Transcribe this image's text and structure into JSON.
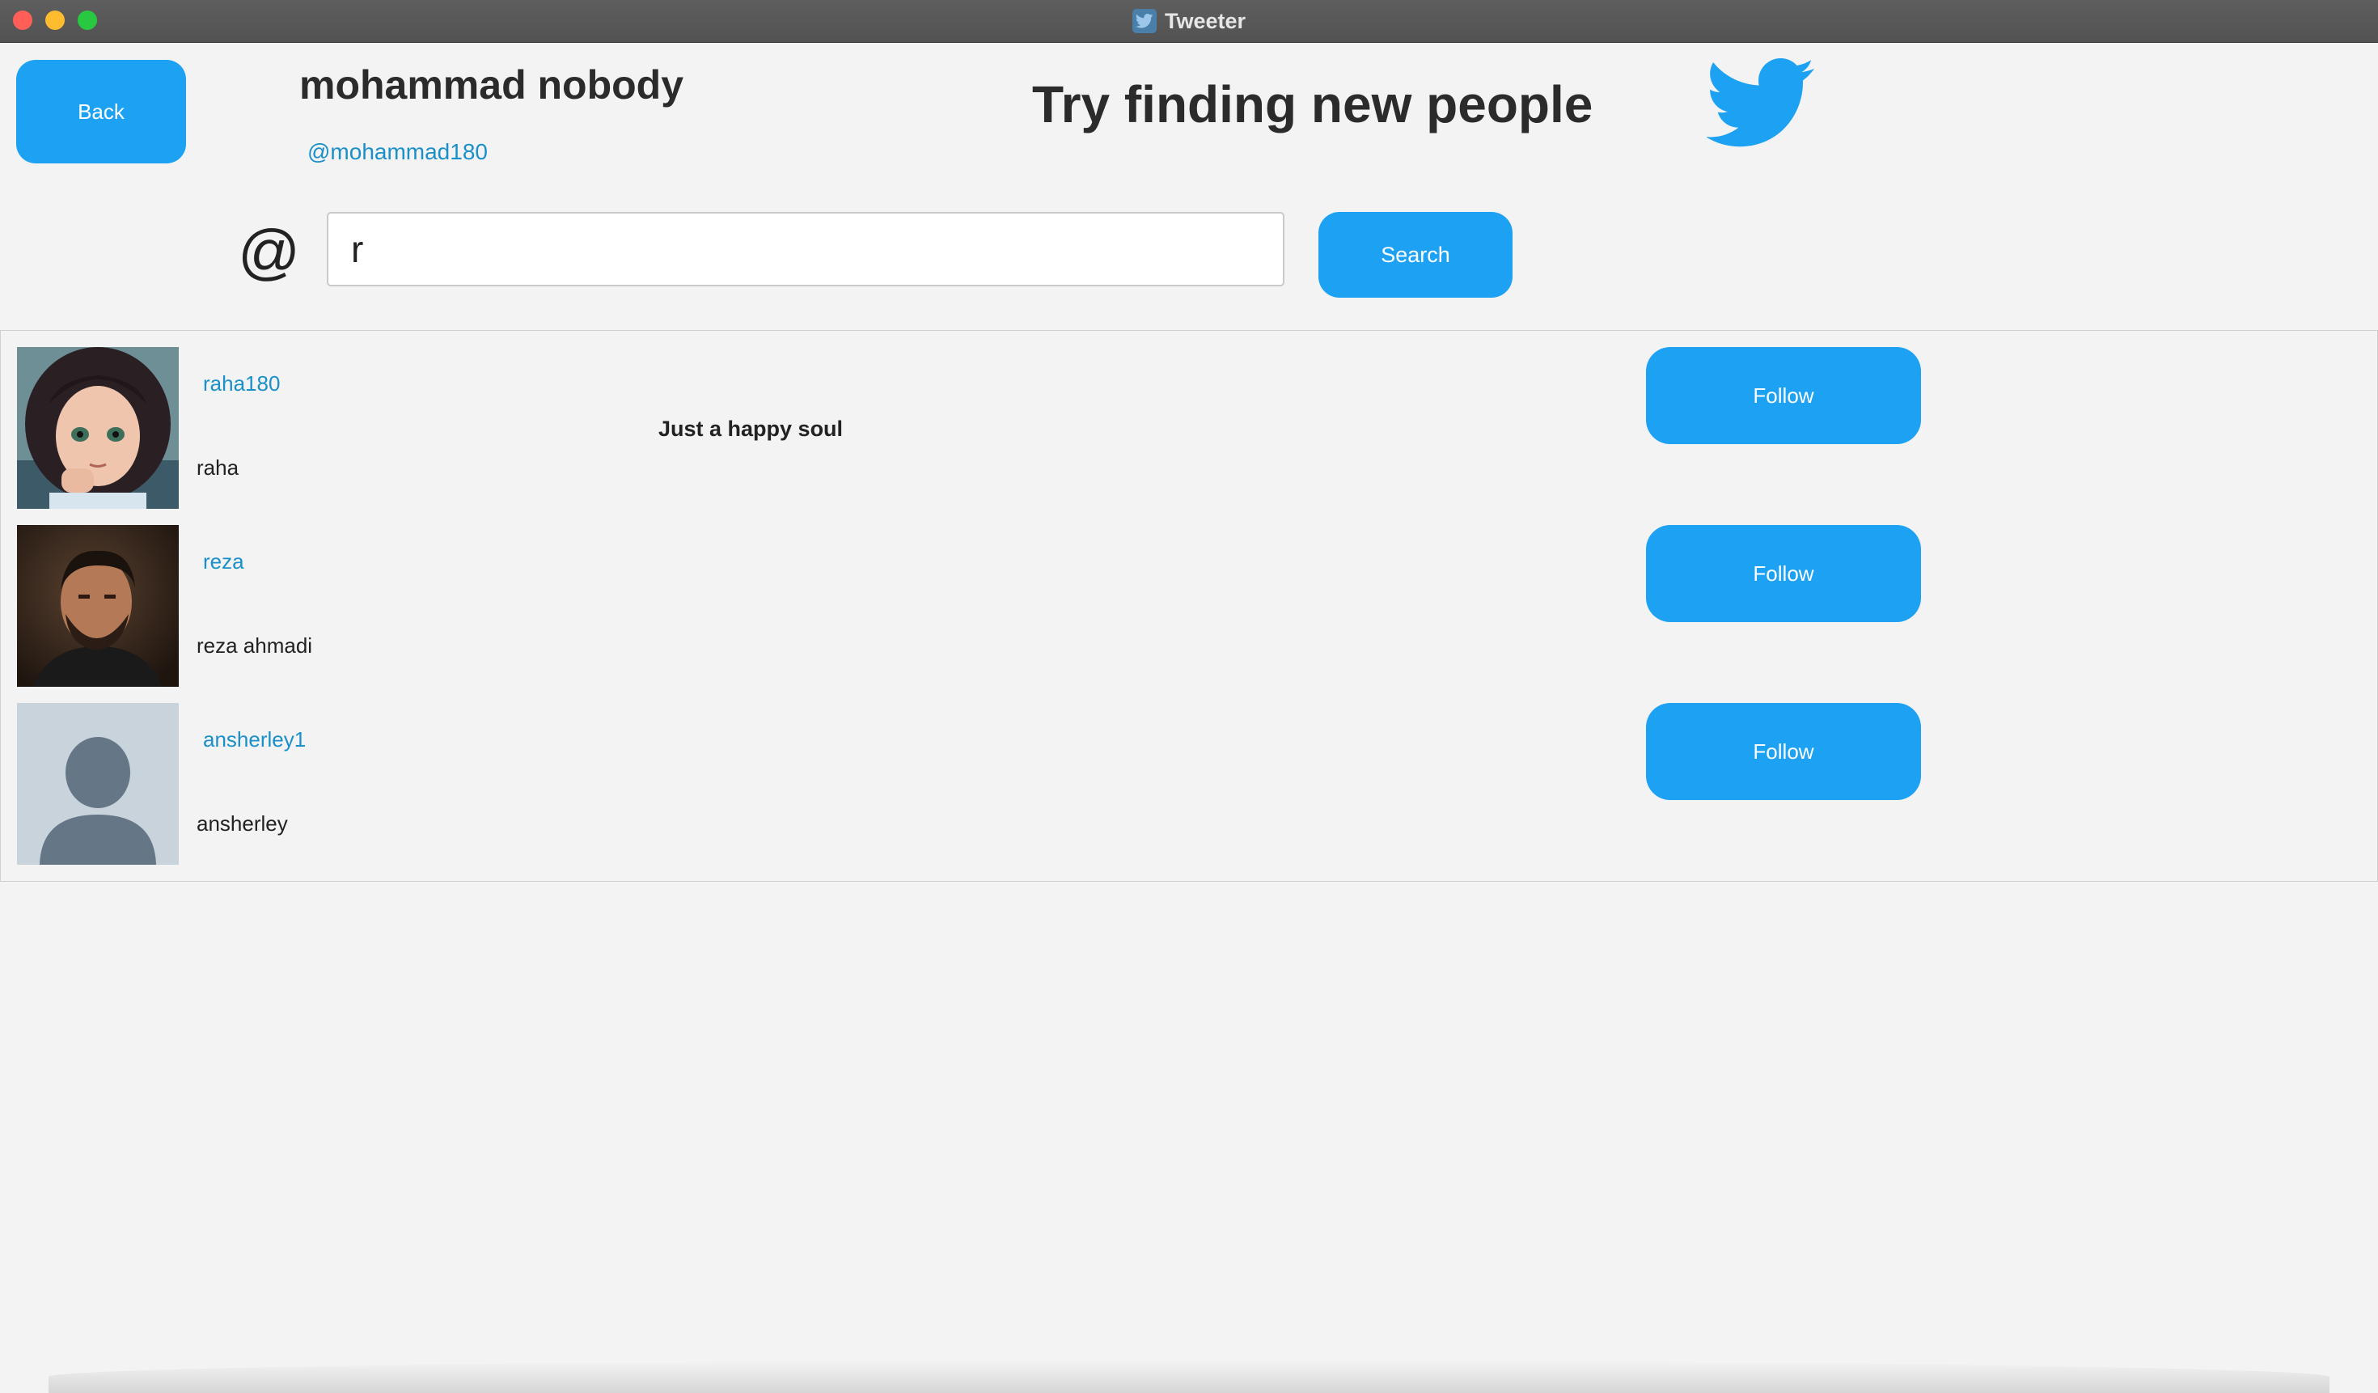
{
  "window": {
    "title": "Tweeter"
  },
  "header": {
    "back_label": "Back",
    "user_name": "mohammad nobody",
    "user_handle": "@mohammad180",
    "heading": "Try finding new people"
  },
  "search": {
    "at_symbol": "@",
    "value": "r",
    "button_label": "Search"
  },
  "results": [
    {
      "username": "raha180",
      "display_name": "raha",
      "bio": "Just a happy soul",
      "follow_label": "Follow",
      "avatar": "cartoon-girl-avatar"
    },
    {
      "username": "reza",
      "display_name": "reza ahmadi",
      "bio": "",
      "follow_label": "Follow",
      "avatar": "man-portrait-avatar"
    },
    {
      "username": "ansherley1",
      "display_name": "ansherley",
      "bio": "",
      "follow_label": "Follow",
      "avatar": "default-person-avatar"
    }
  ],
  "colors": {
    "accent": "#1da1f2",
    "link": "#1a8fc8",
    "background": "#f3f3f3",
    "titlebar": "#555555"
  },
  "icons": {
    "logo": "twitter-bird-icon",
    "app": "tweeter-app-icon"
  }
}
